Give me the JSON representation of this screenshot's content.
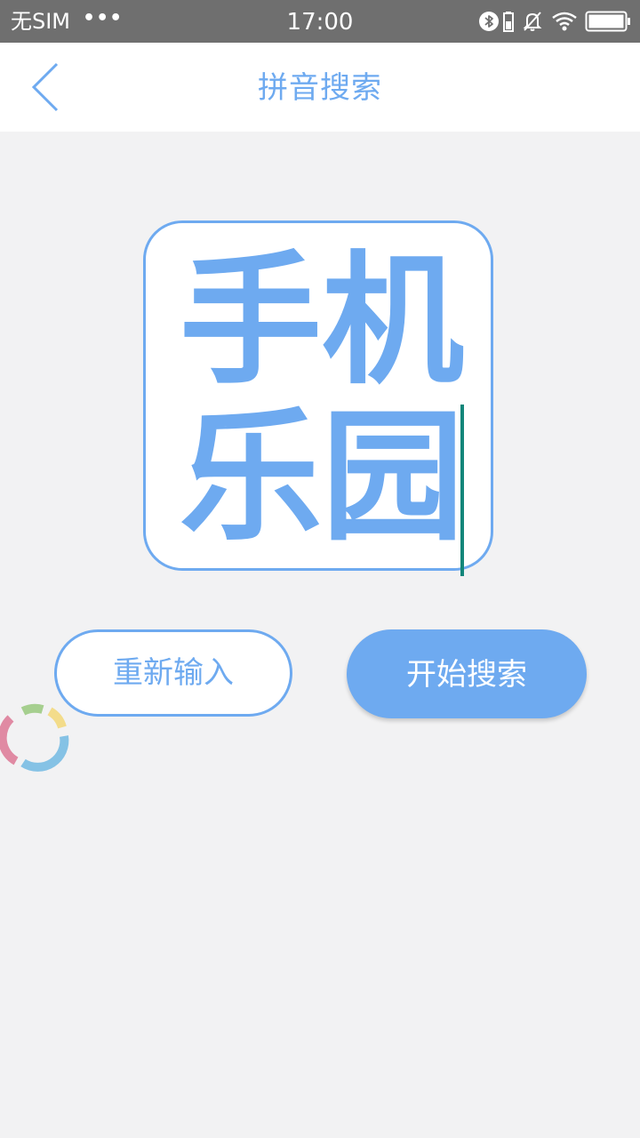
{
  "status_bar": {
    "carrier": "无SIM",
    "dots": "•••",
    "time": "17:00",
    "icons": [
      "bluetooth-icon",
      "battery-small-icon",
      "mute-bell-icon",
      "wifi-icon",
      "battery-icon"
    ]
  },
  "header": {
    "title": "拼音搜索",
    "back_icon": "chevron-left-icon"
  },
  "input_display": {
    "characters": [
      "手",
      "机",
      "乐",
      "园"
    ]
  },
  "buttons": {
    "reset_label": "重新输入",
    "search_label": "开始搜索"
  },
  "colors": {
    "accent": "#6eaaf0",
    "caret": "#13867a",
    "background": "#f2f2f3",
    "status_bar": "#6f6f6f"
  },
  "floating_button": {
    "icon": "assistive-ring-icon"
  }
}
